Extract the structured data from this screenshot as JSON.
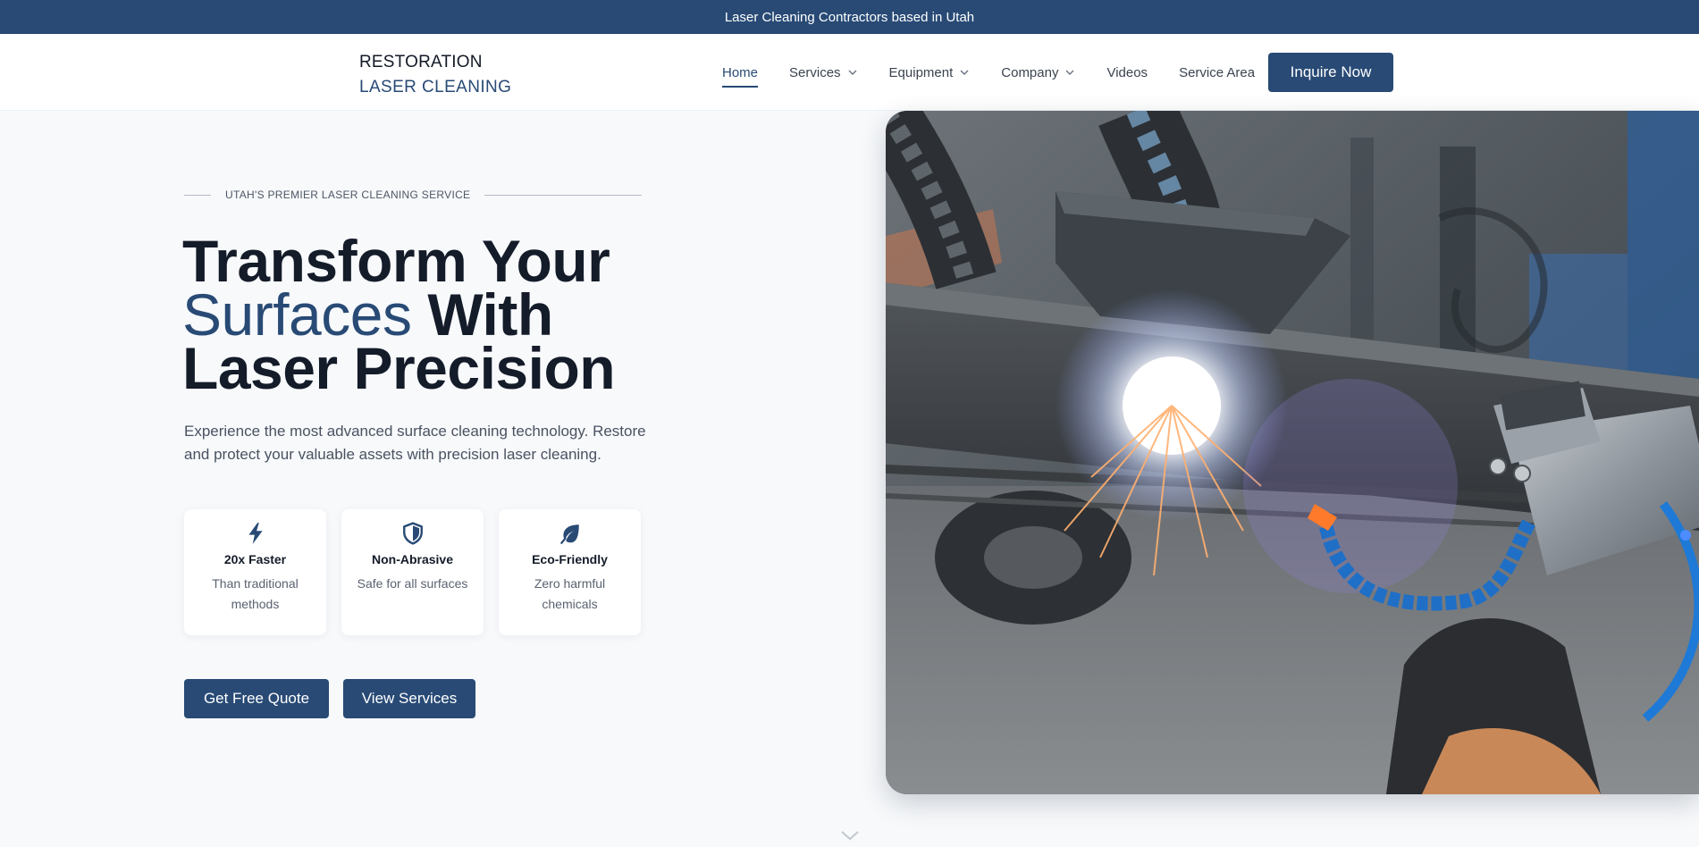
{
  "topbar": {
    "text": "Laser Cleaning Contractors based in Utah"
  },
  "logo": {
    "line1": "RESTORATION",
    "line2": "LASER CLEANING"
  },
  "nav": {
    "items": [
      {
        "label": "Home",
        "active": true,
        "dropdown": false
      },
      {
        "label": "Services",
        "active": false,
        "dropdown": true
      },
      {
        "label": "Equipment",
        "active": false,
        "dropdown": true
      },
      {
        "label": "Company",
        "active": false,
        "dropdown": true
      },
      {
        "label": "Videos",
        "active": false,
        "dropdown": false
      },
      {
        "label": "Service Area",
        "active": false,
        "dropdown": false
      }
    ],
    "cta_label": "Inquire Now"
  },
  "hero": {
    "tagline": "UTAH'S PREMIER LASER CLEANING SERVICE",
    "headline_part1": "Transform Your",
    "headline_accent": "Surfaces",
    "headline_part2": "With",
    "headline_part3": "Laser Precision",
    "subtext": "Experience the most advanced surface cleaning technology. Restore and protect your valuable assets with precision laser cleaning.",
    "features": [
      {
        "icon": "lightning-bolt-icon",
        "title": "20x Faster",
        "desc": "Than traditional methods"
      },
      {
        "icon": "shield-icon",
        "title": "Non-Abrasive",
        "desc": "Safe for all surfaces"
      },
      {
        "icon": "leaf-icon",
        "title": "Eco-Friendly",
        "desc": "Zero harmful chemicals"
      }
    ],
    "primary_button": "Get Free Quote",
    "secondary_button": "View Services"
  },
  "colors": {
    "brand": "#284a75",
    "heading": "#141b29",
    "background": "#f7f9fb"
  }
}
